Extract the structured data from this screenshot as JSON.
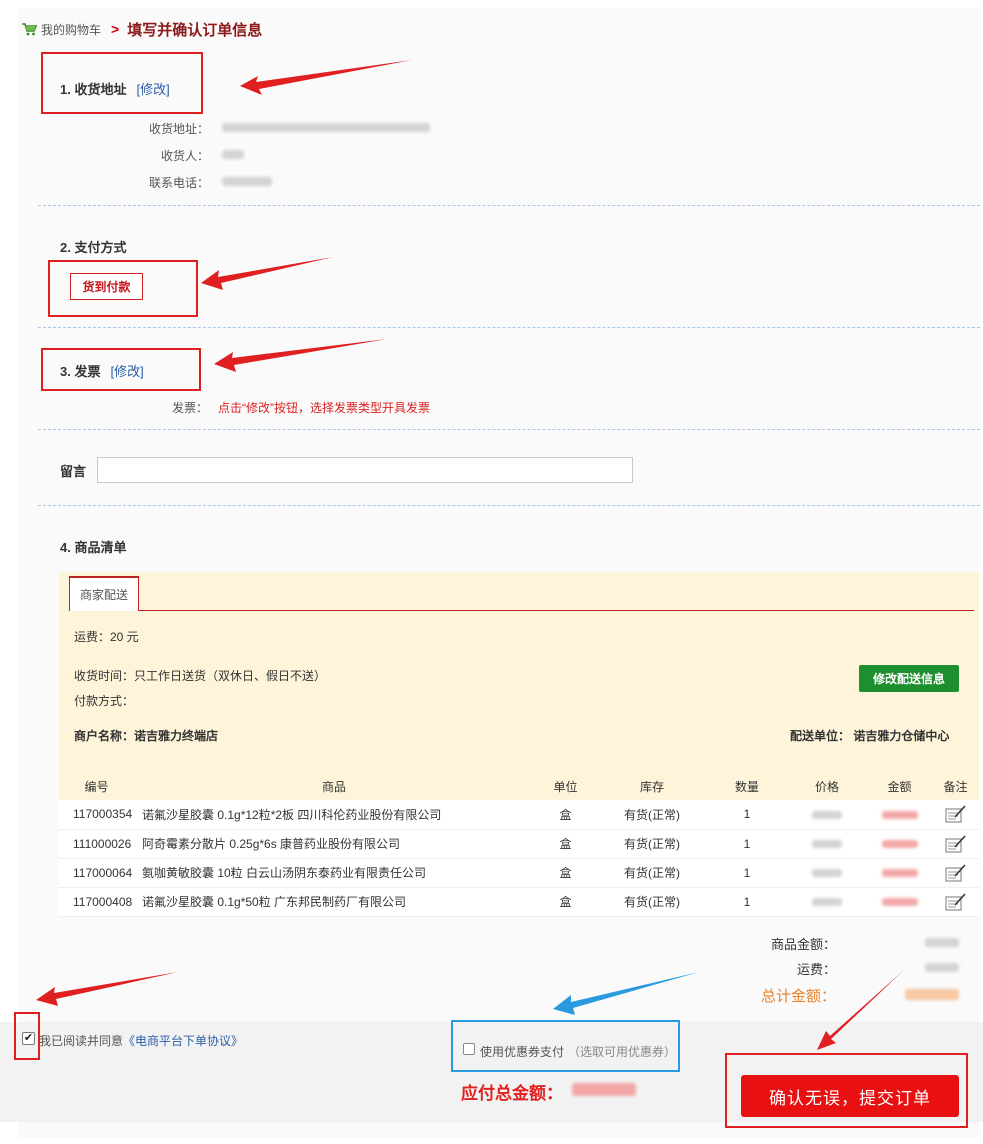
{
  "breadcrumb": {
    "link": "我的购物车",
    "separator": ">",
    "current": "填写并确认订单信息"
  },
  "address": {
    "title": "1. 收货地址",
    "modify": "[修改]",
    "fields": [
      {
        "label": "收货地址："
      },
      {
        "label": "收货人："
      },
      {
        "label": "联系电话："
      }
    ]
  },
  "payment": {
    "title": "2. 支付方式",
    "method": "货到付款"
  },
  "invoice": {
    "title": "3. 发票",
    "modify": "[修改]",
    "label": "发票：",
    "hint": "点击“修改”按钮，选择发票类型开具发票"
  },
  "message": {
    "label": "留言",
    "value": ""
  },
  "items_section": {
    "title": "4. 商品清单",
    "tab": "商家配送",
    "shipping_fee": "运费：20 元",
    "delivery_time": "收货时间：只工作日送货（双休日、假日不送）",
    "payment_way": "付款方式：",
    "merchant": "商户名称：诺吉雅力终端店",
    "carrier": "配送单位： 诺吉雅力仓储中心",
    "modify_delivery_button": "修改配送信息"
  },
  "table": {
    "headers": [
      "编号",
      "商品",
      "单位",
      "库存",
      "数量",
      "价格",
      "金额",
      "备注"
    ],
    "rows": [
      {
        "id": "117000354",
        "name": "诺氟沙星胶囊 0.1g*12粒*2板 四川科伦药业股份有限公司",
        "unit": "盒",
        "stock": "有货(正常)",
        "qty": "1"
      },
      {
        "id": "111000026",
        "name": "阿奇霉素分散片 0.25g*6s 康普药业股份有限公司",
        "unit": "盒",
        "stock": "有货(正常)",
        "qty": "1"
      },
      {
        "id": "117000064",
        "name": "氨咖黄敏胶囊 10粒 白云山汤阴东泰药业有限责任公司",
        "unit": "盒",
        "stock": "有货(正常)",
        "qty": "1"
      },
      {
        "id": "117000408",
        "name": "诺氟沙星胶囊 0.1g*50粒 广东邦民制药厂有限公司",
        "unit": "盒",
        "stock": "有货(正常)",
        "qty": "1"
      }
    ]
  },
  "summary": {
    "goods_amount_label": "商品金额：",
    "freight_label": "运费：",
    "total_label": "总计金额："
  },
  "footer": {
    "agree_text": "我已阅读并同意",
    "agreement_link": "《电商平台下单协议》",
    "coupon_label": "使用优惠券支付",
    "coupon_hint": "（选取可用优惠券）",
    "pay_total_label": "应付总金额：",
    "submit_button": "确认无误，提交订单"
  },
  "colors": {
    "accent_red": "#e02020",
    "link_blue": "#2b5fa8",
    "green": "#1d8f2e",
    "panel_bg": "#fdf4d9",
    "annotation_blue": "#2a9ae0"
  }
}
